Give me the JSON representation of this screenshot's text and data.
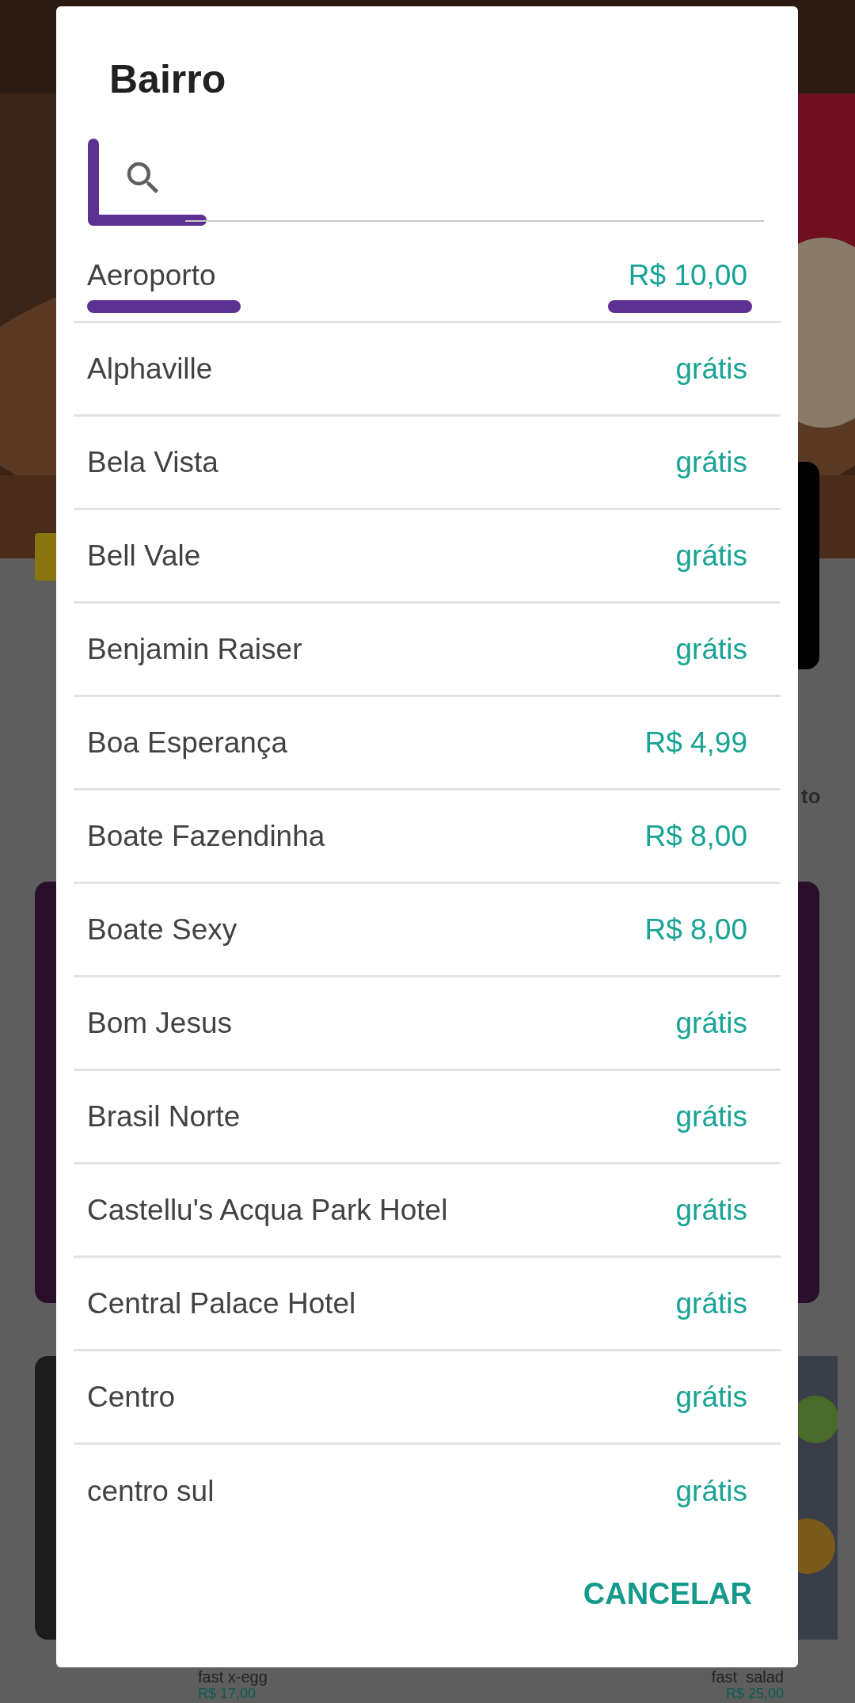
{
  "background": {
    "side_text": "to",
    "products": [
      {
        "name": "fast x-egg",
        "price": "R$ 17,00"
      },
      {
        "name": "fast  salad",
        "price": "R$ 25,00"
      }
    ]
  },
  "dialog": {
    "title": "Bairro",
    "search": {
      "marked": true
    },
    "items": [
      {
        "name": "Aeroporto",
        "fee": "R$ 10,00",
        "marked": true
      },
      {
        "name": "Alphaville",
        "fee": "grátis",
        "marked": false
      },
      {
        "name": "Bela Vista",
        "fee": "grátis",
        "marked": false
      },
      {
        "name": "Bell Vale",
        "fee": "grátis",
        "marked": false
      },
      {
        "name": "Benjamin Raiser",
        "fee": "grátis",
        "marked": false
      },
      {
        "name": "Boa Esperança",
        "fee": "R$ 4,99",
        "marked": false
      },
      {
        "name": "Boate Fazendinha",
        "fee": "R$ 8,00",
        "marked": false
      },
      {
        "name": "Boate Sexy",
        "fee": "R$ 8,00",
        "marked": false
      },
      {
        "name": "Bom Jesus",
        "fee": "grátis",
        "marked": false
      },
      {
        "name": "Brasil Norte",
        "fee": "grátis",
        "marked": false
      },
      {
        "name": "Castellu's Acqua Park Hotel",
        "fee": "grátis",
        "marked": false
      },
      {
        "name": "Central Palace Hotel",
        "fee": "grátis",
        "marked": false
      },
      {
        "name": "Centro",
        "fee": "grátis",
        "marked": false
      },
      {
        "name": "centro sul",
        "fee": "grátis",
        "marked": false
      }
    ],
    "cancel_button": "CANCELAR"
  }
}
